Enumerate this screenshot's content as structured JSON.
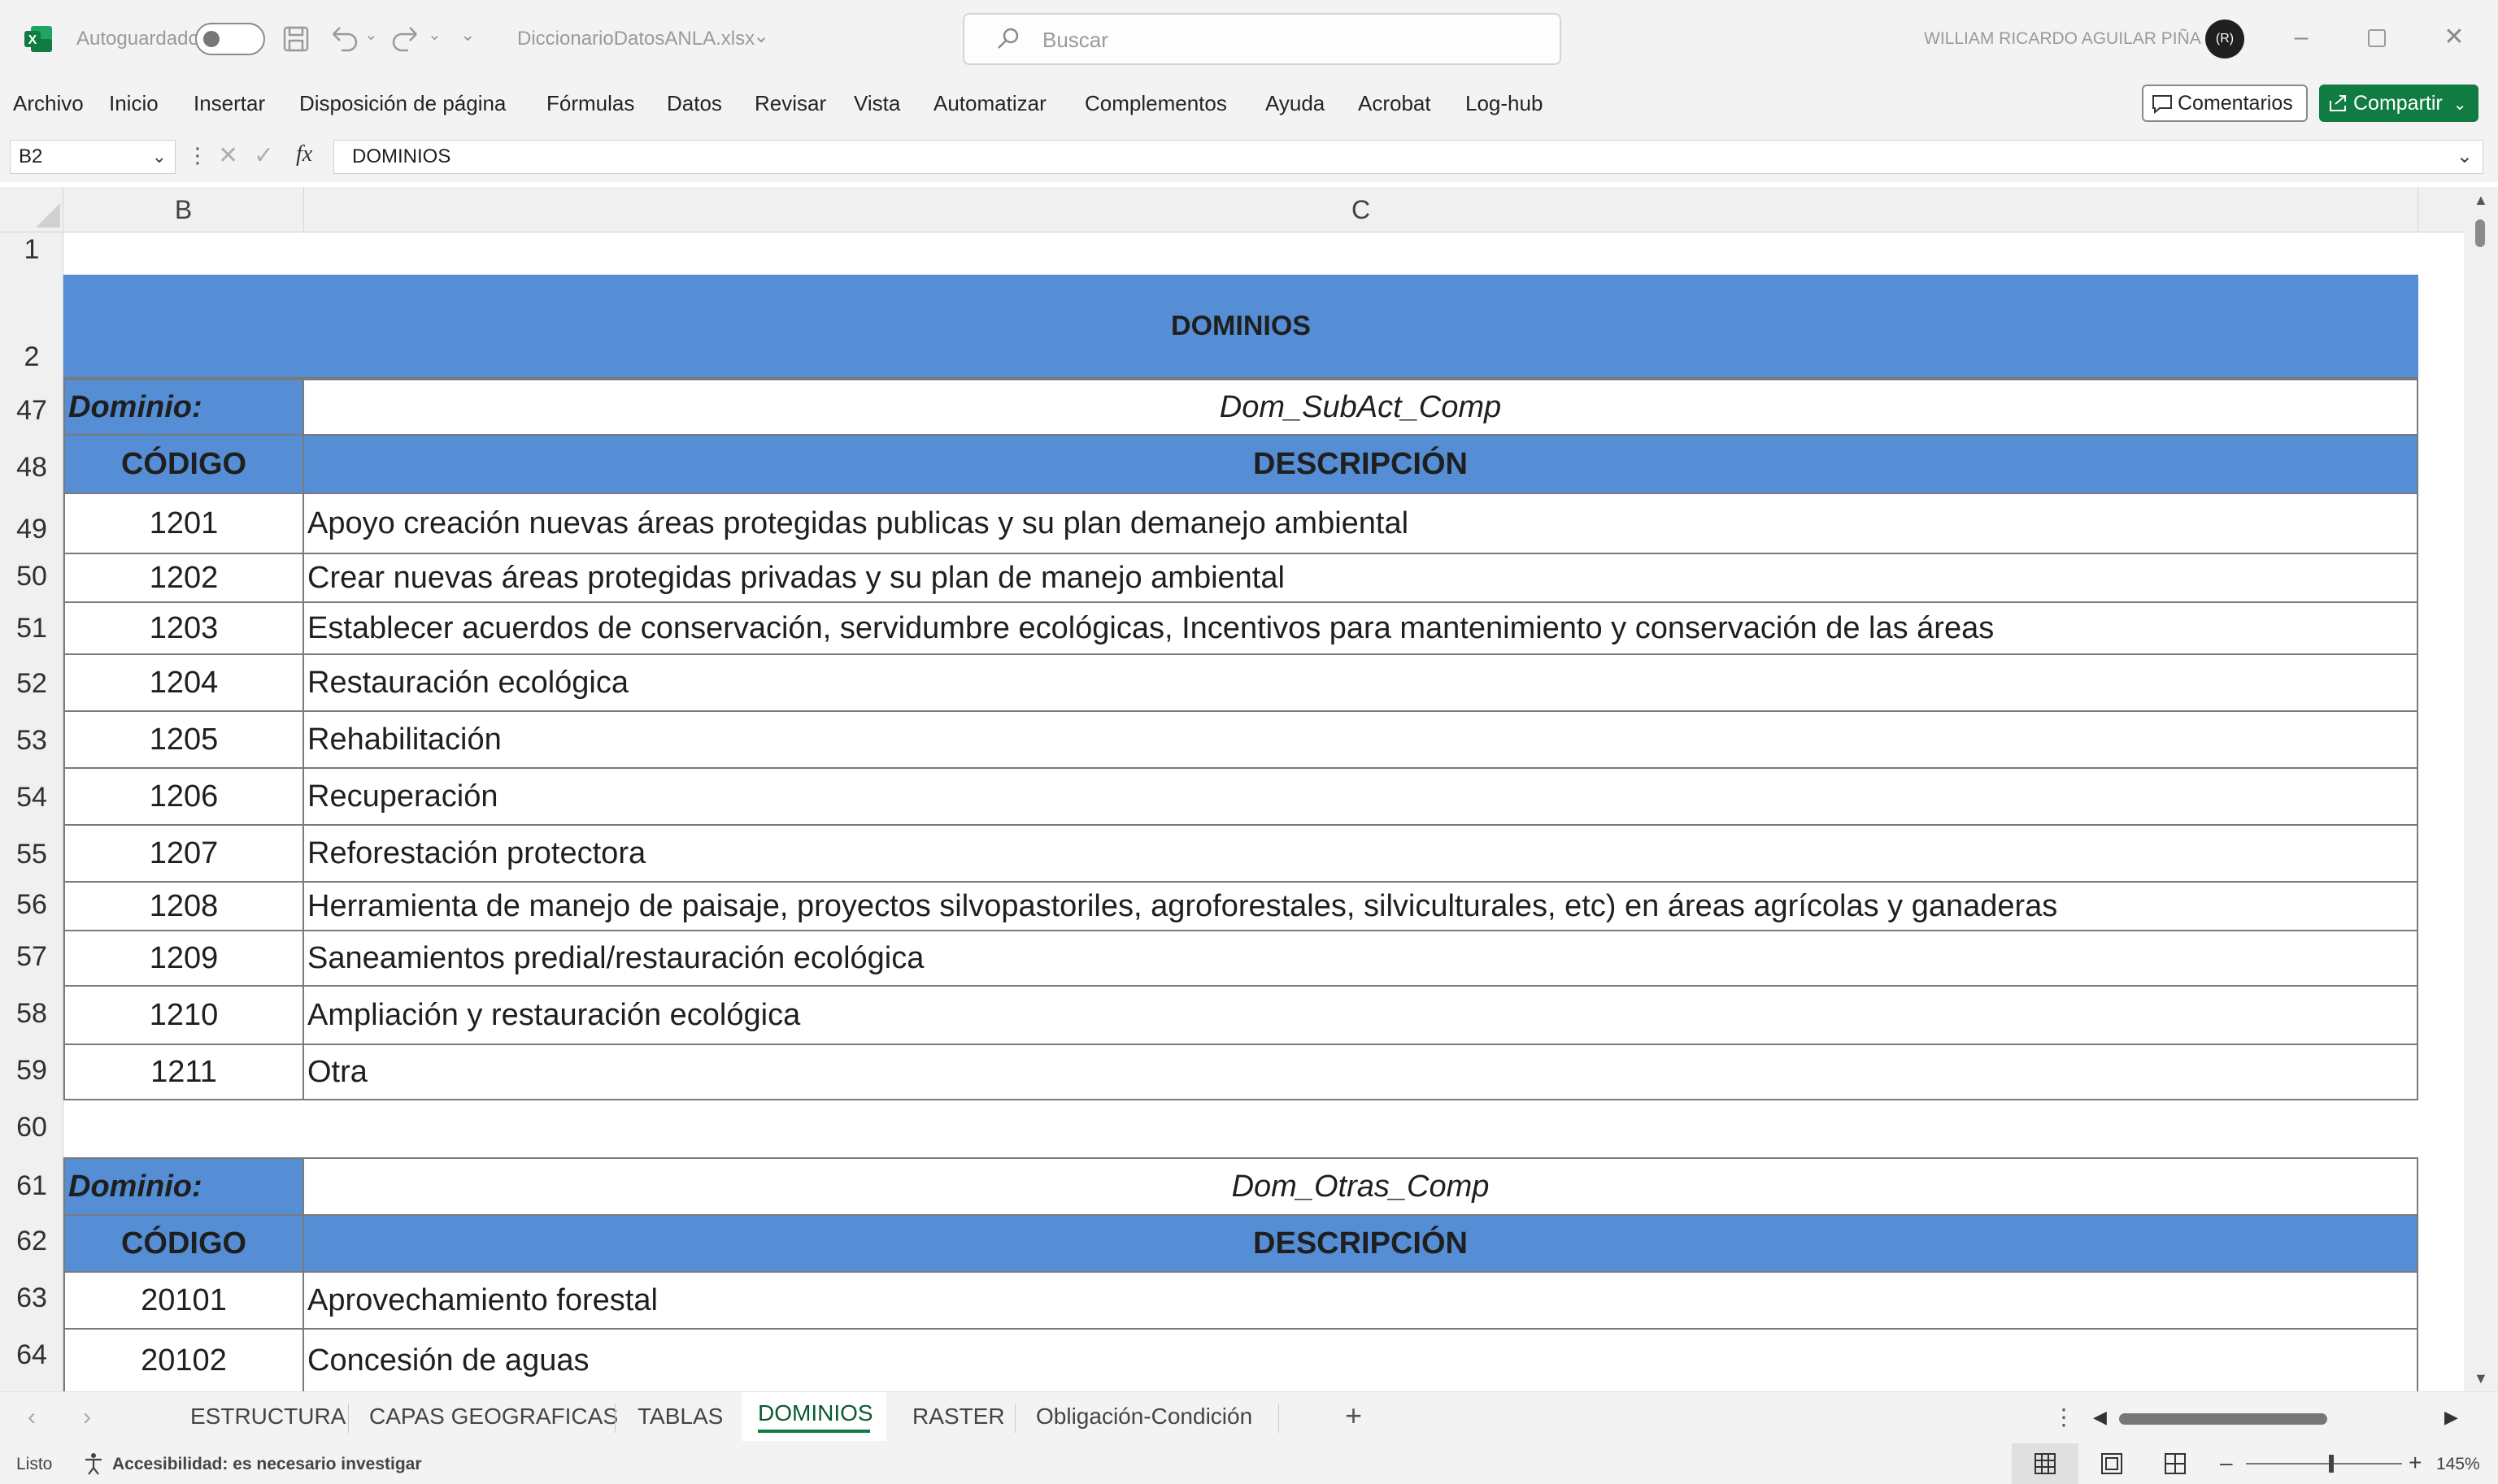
{
  "titlebar": {
    "autosave_label": "Autoguardado",
    "filename": "DiccionarioDatosANLA.xlsx",
    "search_placeholder": "Buscar",
    "user_name": "WILLIAM RICARDO AGUILAR PIÑA",
    "user_initials": "(R)"
  },
  "menu": {
    "items": [
      "Archivo",
      "Inicio",
      "Insertar",
      "Disposición de página",
      "Fórmulas",
      "Datos",
      "Revisar",
      "Vista",
      "Automatizar",
      "Complementos",
      "Ayuda",
      "Acrobat",
      "Log-hub"
    ],
    "comments_label": "Comentarios",
    "share_label": "Compartir"
  },
  "formula_bar": {
    "cell_ref": "B2",
    "fx_symbol": "fx",
    "content": "DOMINIOS"
  },
  "columns": [
    "B",
    "C"
  ],
  "rows": {
    "r1": "1",
    "r2": "2",
    "r47": "47",
    "r48": "48",
    "r49": "49",
    "r50": "50",
    "r51": "51",
    "r52": "52",
    "r53": "53",
    "r54": "54",
    "r55": "55",
    "r56": "56",
    "r57": "57",
    "r58": "58",
    "r59": "59",
    "r60": "60",
    "r61": "61",
    "r62": "62",
    "r63": "63",
    "r64": "64"
  },
  "sheet": {
    "banner": "DOMINIOS",
    "domain1": {
      "label": "Dominio:",
      "name": "Dom_SubAct_Comp",
      "code_header": "CÓDIGO",
      "desc_header": "DESCRIPCIÓN",
      "entries": [
        {
          "code": "1201",
          "desc": "Apoyo creación nuevas áreas protegidas publicas y su plan demanejo ambiental"
        },
        {
          "code": "1202",
          "desc": "Crear nuevas áreas protegidas privadas y su plan de manejo ambiental"
        },
        {
          "code": "1203",
          "desc": "Establecer acuerdos de conservación, servidumbre ecológicas, Incentivos para mantenimiento y conservación de las áreas"
        },
        {
          "code": "1204",
          "desc": "Restauración ecológica"
        },
        {
          "code": "1205",
          "desc": "Rehabilitación"
        },
        {
          "code": "1206",
          "desc": "Recuperación"
        },
        {
          "code": "1207",
          "desc": "Reforestación protectora"
        },
        {
          "code": "1208",
          "desc": "Herramienta de manejo de paisaje, proyectos silvopastoriles, agroforestales, silviculturales, etc) en áreas agrícolas y ganaderas"
        },
        {
          "code": "1209",
          "desc": "Saneamientos predial/restauración ecológica"
        },
        {
          "code": "1210",
          "desc": "Ampliación y restauración ecológica"
        },
        {
          "code": "1211",
          "desc": "Otra"
        }
      ]
    },
    "domain2": {
      "label": "Dominio:",
      "name": "Dom_Otras_Comp",
      "code_header": "CÓDIGO",
      "desc_header": "DESCRIPCIÓN",
      "entries": [
        {
          "code": "20101",
          "desc": "Aprovechamiento forestal"
        },
        {
          "code": "20102",
          "desc": "Concesión de aguas"
        }
      ]
    }
  },
  "tabs": {
    "items": [
      "ESTRUCTURA",
      "CAPAS GEOGRAFICAS",
      "TABLAS",
      "DOMINIOS",
      "RASTER",
      "Obligación-Condición"
    ],
    "active": "DOMINIOS",
    "add_symbol": "+"
  },
  "status": {
    "ready": "Listo",
    "accessibility": "Accesibilidad: es necesario investigar",
    "zoom": "145%"
  },
  "colors": {
    "accent_blue": "#558ed5",
    "excel_green": "#107c41",
    "border": "#7a7a7a"
  }
}
